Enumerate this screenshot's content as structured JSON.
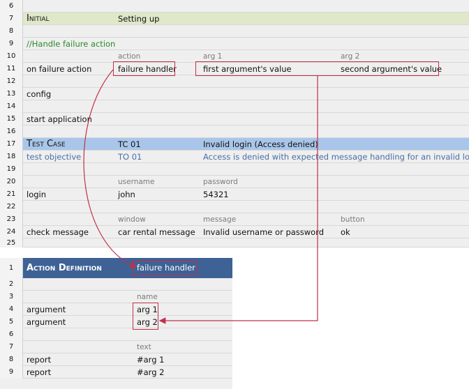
{
  "sheet1": {
    "rows": [
      {
        "n": "6"
      },
      {
        "n": "7",
        "c0": "Initial",
        "c1": "Setting up"
      },
      {
        "n": "8"
      },
      {
        "n": "9",
        "c0": "//Handle failure action"
      },
      {
        "n": "10",
        "c1": "action",
        "c2": "arg 1",
        "c3": "arg 2"
      },
      {
        "n": "11",
        "c0": "on failure action",
        "c1": "failure handler",
        "c2": "first argument's value",
        "c3": "second argument's value"
      },
      {
        "n": "12"
      },
      {
        "n": "13",
        "c0": "config"
      },
      {
        "n": "14"
      },
      {
        "n": "15",
        "c0": "start application"
      },
      {
        "n": "16"
      },
      {
        "n": "17",
        "c0": "Test Case",
        "c1": "TC 01",
        "c2": "Invalid login (Access denied)"
      },
      {
        "n": "18",
        "c0": "test objective",
        "c1": "TO 01",
        "c2": "Access is denied with expected message handling for an invalid login"
      },
      {
        "n": "19"
      },
      {
        "n": "20",
        "c1": "username",
        "c2": "password"
      },
      {
        "n": "21",
        "c0": "login",
        "c1": "john",
        "c2": "54321"
      },
      {
        "n": "22"
      },
      {
        "n": "23",
        "c1": "window",
        "c2": "message",
        "c3": "button"
      },
      {
        "n": "24",
        "c0": "check message",
        "c1": "car rental message",
        "c2": "Invalid username or password",
        "c3": "ok"
      },
      {
        "n": "25"
      }
    ]
  },
  "sheet2": {
    "title": "Action Definition",
    "title_value": "failure handler",
    "rows": [
      {
        "n": "1"
      },
      {
        "n": "2"
      },
      {
        "n": "3",
        "c1": "name"
      },
      {
        "n": "4",
        "c0": "argument",
        "c1": "arg 1"
      },
      {
        "n": "5",
        "c0": "argument",
        "c1": "arg 2"
      },
      {
        "n": "6"
      },
      {
        "n": "7",
        "c1": "text"
      },
      {
        "n": "8",
        "c0": "report",
        "c1": "#arg 1"
      },
      {
        "n": "9",
        "c0": "report",
        "c1": "#arg 2"
      }
    ]
  },
  "colors": {
    "initial_band": "#dfe8c8",
    "testcase_band": "#a9c6ea",
    "action_def_header": "#3e6295",
    "highlight_box": "#c0304a",
    "comment_text": "#2a8a2a"
  }
}
